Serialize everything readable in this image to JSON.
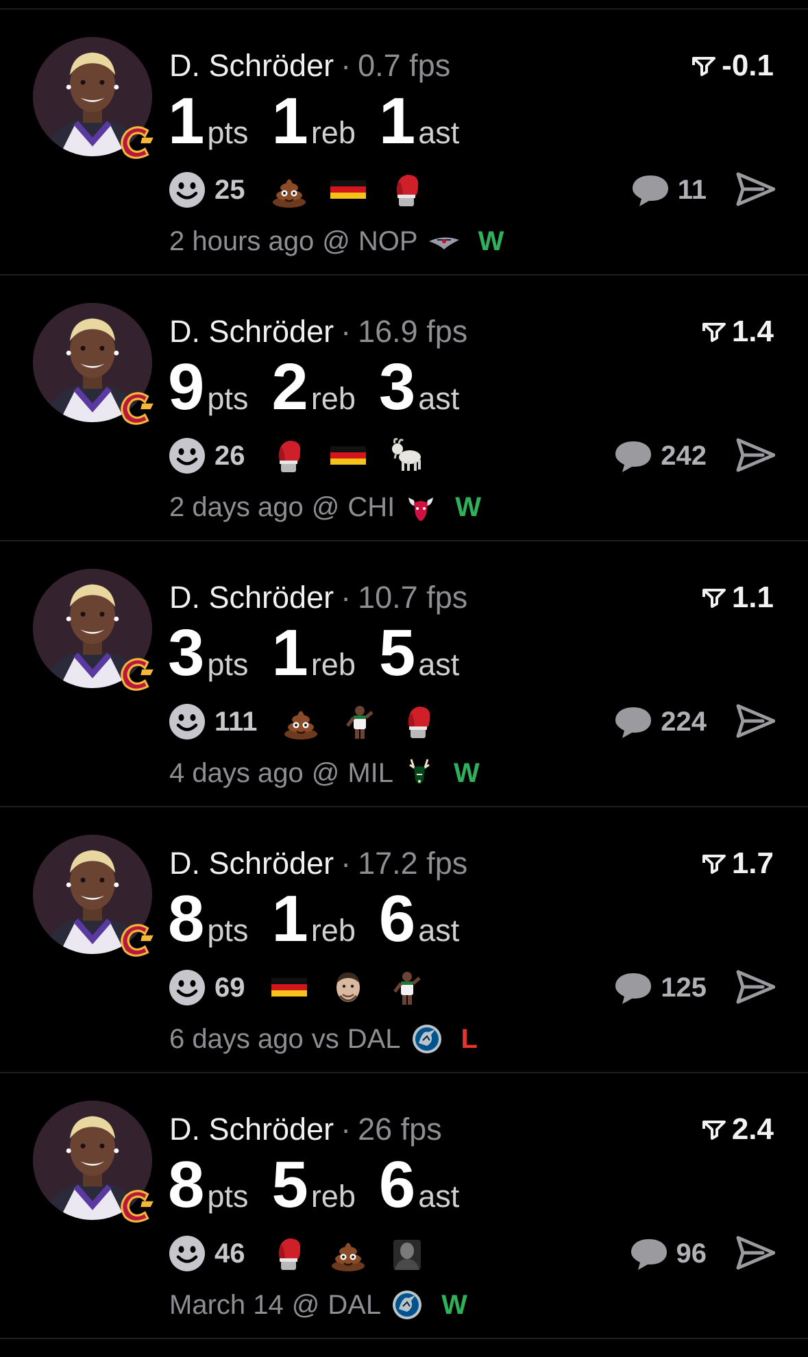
{
  "colors": {
    "background": "#000000",
    "win": "#2fb15a",
    "loss": "#e5342d",
    "muted": "#8e8e93"
  },
  "feed": [
    {
      "player": "D. Schröder",
      "separator": "·",
      "fps": "0.7 fps",
      "score": "-0.1",
      "pts": "1",
      "reb": "1",
      "ast": "1",
      "pts_label": "pts",
      "reb_label": "reb",
      "ast_label": "ast",
      "reaction_count": "25",
      "emojis": [
        "poop-emoji",
        "germany-flag",
        "boxing-glove-emoji"
      ],
      "comment_count": "11",
      "time": "2 hours ago",
      "venue": "@",
      "opponent": "NOP",
      "opponent_logo": "pelicans-logo",
      "result": "W"
    },
    {
      "player": "D. Schröder",
      "separator": "·",
      "fps": "16.9 fps",
      "score": "1.4",
      "pts": "9",
      "reb": "2",
      "ast": "3",
      "pts_label": "pts",
      "reb_label": "reb",
      "ast_label": "ast",
      "reaction_count": "26",
      "emojis": [
        "boxing-glove-emoji",
        "germany-flag",
        "goat-emoji"
      ],
      "comment_count": "242",
      "time": "2 days ago",
      "venue": "@",
      "opponent": "CHI",
      "opponent_logo": "bulls-logo",
      "result": "W"
    },
    {
      "player": "D. Schröder",
      "separator": "·",
      "fps": "10.7 fps",
      "score": "1.1",
      "pts": "3",
      "reb": "1",
      "ast": "5",
      "pts_label": "pts",
      "reb_label": "reb",
      "ast_label": "ast",
      "reaction_count": "111",
      "emojis": [
        "poop-emoji",
        "player-sticker",
        "boxing-glove-emoji"
      ],
      "comment_count": "224",
      "time": "4 days ago",
      "venue": "@",
      "opponent": "MIL",
      "opponent_logo": "bucks-logo",
      "result": "W"
    },
    {
      "player": "D. Schröder",
      "separator": "·",
      "fps": "17.2 fps",
      "score": "1.7",
      "pts": "8",
      "reb": "1",
      "ast": "6",
      "pts_label": "pts",
      "reb_label": "reb",
      "ast_label": "ast",
      "reaction_count": "69",
      "emojis": [
        "germany-flag",
        "face-sticker",
        "player-sticker"
      ],
      "comment_count": "125",
      "time": "6 days ago",
      "venue": "vs",
      "opponent": "DAL",
      "opponent_logo": "mavericks-logo",
      "result": "L"
    },
    {
      "player": "D. Schröder",
      "separator": "·",
      "fps": "26 fps",
      "score": "2.4",
      "pts": "8",
      "reb": "5",
      "ast": "6",
      "pts_label": "pts",
      "reb_label": "reb",
      "ast_label": "ast",
      "reaction_count": "46",
      "emojis": [
        "boxing-glove-emoji",
        "poop-emoji",
        "person-sticker"
      ],
      "comment_count": "96",
      "time": "March 14",
      "venue": "@",
      "opponent": "DAL",
      "opponent_logo": "mavericks-logo",
      "result": "W"
    }
  ]
}
